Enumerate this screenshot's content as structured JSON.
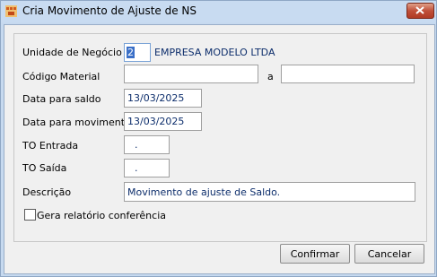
{
  "window": {
    "title": "Cria Movimento de Ajuste de NS"
  },
  "form": {
    "unit_label": "Unidade de Negócio",
    "unit_code": "2",
    "unit_name": "EMPRESA MODELO LTDA",
    "material_label": "Código Material",
    "material_from": "",
    "material_sep": "a",
    "material_to": "",
    "saldo_date_label": "Data para saldo",
    "saldo_date": "13/03/2025",
    "mov_date_label": "Data para movimentos",
    "mov_date": "13/03/2025",
    "to_entrada_label": "TO Entrada",
    "to_entrada": ".",
    "to_saida_label": "TO Saída",
    "to_saida": ".",
    "description_label": "Descrição",
    "description": "Movimento de ajuste de Saldo.",
    "report_check_label": "Gera relatório conferência",
    "report_checked": false
  },
  "buttons": {
    "confirm": "Confirmar",
    "cancel": "Cancelar"
  }
}
